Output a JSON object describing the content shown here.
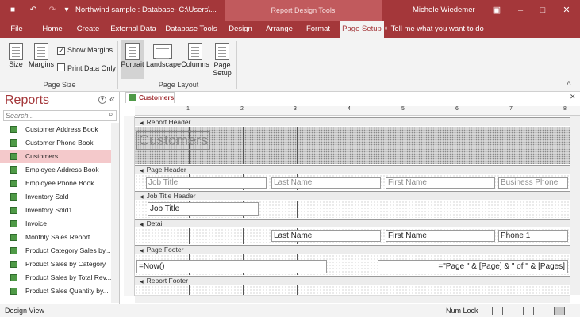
{
  "titlebar": {
    "doc_title": "Northwind sample : Database- C:\\Users\\...",
    "tools_label": "Report Design Tools",
    "user": "Michele Wiedemer",
    "qa_save": "■",
    "qa_undo": "↶",
    "qa_redo": "↷",
    "qa_customize": "▾",
    "minimize": "–",
    "maximize": "□",
    "close": "✕",
    "ribbon_options": "▣"
  },
  "tabs": [
    "File",
    "Home",
    "Create",
    "External Data",
    "Database Tools",
    "Design",
    "Arrange",
    "Format",
    "Page Setup"
  ],
  "active_tab": "Page Setup",
  "tellme": "♀ Tell me what you want to do",
  "ribbon": {
    "page_size": {
      "label": "Page Size",
      "size": "Size",
      "margins": "Margins",
      "show_margins": "Show Margins",
      "show_margins_checked": "✓",
      "print_data_only": "Print Data Only"
    },
    "page_layout": {
      "label": "Page Layout",
      "portrait": "Portrait",
      "landscape": "Landscape",
      "columns": "Columns",
      "page_setup_line1": "Page",
      "page_setup_line2": "Setup"
    },
    "collapse": "˄"
  },
  "nav": {
    "title": "Reports",
    "collapse": "«",
    "menu": "▾",
    "search_placeholder": "Search...",
    "search_icon": "⌕",
    "items": [
      "Customer Address Book",
      "Customer Phone Book",
      "Customers",
      "Employee Address Book",
      "Employee Phone Book",
      "Inventory Sold",
      "Inventory Sold1",
      "Invoice",
      "Monthly Sales Report",
      "Product Category Sales by...",
      "Product Sales by Category",
      "Product Sales by Total Rev...",
      "Product Sales Quantity by..."
    ],
    "selected": "Customers"
  },
  "document": {
    "tab": "Customers",
    "close": "✕",
    "ruler": [
      "1",
      "2",
      "3",
      "4",
      "5",
      "6",
      "7",
      "8"
    ],
    "report_header": "Report Header",
    "report_title": "Customers",
    "page_header": "Page Header",
    "page_header_labels": [
      "Job Title",
      "Last Name",
      "First Name",
      "Business Phone"
    ],
    "group_header": "Job Title Header",
    "group_field": "Job Title",
    "detail": "Detail",
    "detail_fields": [
      "Last Name",
      "First Name",
      "Phone 1"
    ],
    "page_footer": "Page Footer",
    "footer_now": "=Now()",
    "footer_pages": "=\"Page \" & [Page] & \" of \" & [Pages]",
    "report_footer": "Report Footer"
  },
  "status": {
    "left": "Design View",
    "numlock": "Num Lock"
  }
}
